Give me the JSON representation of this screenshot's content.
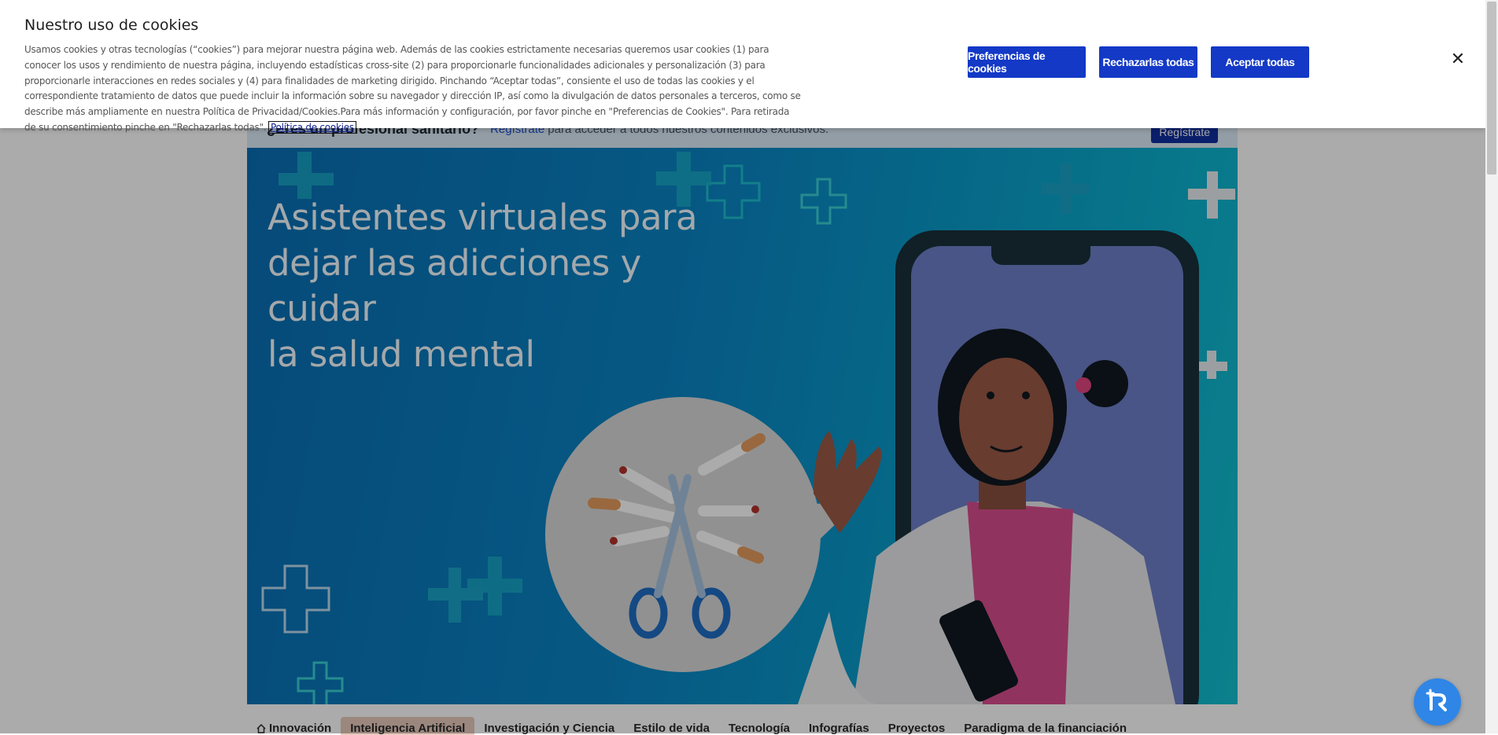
{
  "registration": {
    "question": "¿Eres un profesional sanitario?",
    "link": "Regístrate",
    "text": "para acceder a todos nuestros contenidos exclusivos.",
    "button": "Regístrate"
  },
  "hero": {
    "title_line1": "Asistentes virtuales para",
    "title_line2": "dejar las adicciones y cuidar",
    "title_line3": "la salud mental"
  },
  "categories": [
    {
      "label": "Innovación",
      "icon": "home-icon"
    },
    {
      "label": "Inteligencia Artificial",
      "active": true
    },
    {
      "label": "Investigación y Ciencia"
    },
    {
      "label": "Estilo de vida"
    },
    {
      "label": "Tecnología"
    },
    {
      "label": "Infografías"
    },
    {
      "label": "Proyectos"
    },
    {
      "label": "Paradigma de la financiación"
    }
  ],
  "cookie_banner": {
    "title": "Nuestro uso de cookies",
    "body": "Usamos cookies y otras tecnologías (“cookies”) para mejorar nuestra página web. Además de las cookies estrictamente necesarias queremos usar cookies (1) para conocer los usos y rendimiento de nuestra página, incluyendo estadísticas cross-site (2) para proporcionarle funcionalidades adicionales y personalización (3) para proporcionarle interacciones en redes sociales y (4) para finalidades de marketing dirigido. Pinchando “Aceptar todas”, consiente el uso de todas las cookies y el correspondiente tratamiento de datos que puede incluir la información sobre su navegador y dirección IP, así como la divulgación de datos personales a terceros, como se describe más ampliamente en nuestra Política de Privacidad/Cookies.Para más información y configuración, por favor pinche en \"Preferencias de Cookies\". Para retirada de su consentimiento pinche en \"Rechazarlas todas\".",
    "policy_link": "Política de cookies",
    "btn_preferences": "Preferencias de cookies",
    "btn_reject": "Rechazarlas todas",
    "btn_accept": "Aceptar todas",
    "close_icon": "close-icon",
    "close_glyph": "✕"
  },
  "colors": {
    "accent": "#1339c6",
    "hero_blue": "#0a86c5",
    "active_tab": "#e8c9bd",
    "assist_button": "#2f86e6"
  }
}
